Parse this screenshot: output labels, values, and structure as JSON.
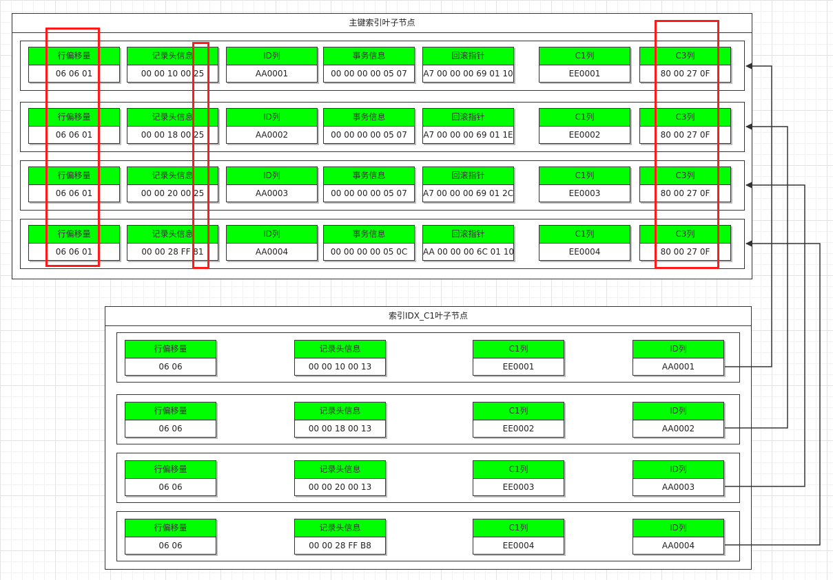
{
  "primary": {
    "title": "主键索引叶子节点",
    "rows": [
      {
        "cells": [
          {
            "h": "行偏移量",
            "v": "06 06 01"
          },
          {
            "h": "记录头信息",
            "v": "00 00 10 00 25"
          },
          {
            "h": "ID列",
            "v": "AA0001"
          },
          {
            "h": "事务信息",
            "v": "00 00 00 00 05 07"
          },
          {
            "h": "回滚指针",
            "v": "A7 00 00 00 69 01 10"
          },
          {
            "h": "C1列",
            "v": "EE0001"
          },
          {
            "h": "C3列",
            "v": "80 00 27 0F"
          }
        ]
      },
      {
        "cells": [
          {
            "h": "行偏移量",
            "v": "06 06 01"
          },
          {
            "h": "记录头信息",
            "v": "00 00 18 00 25"
          },
          {
            "h": "ID列",
            "v": "AA0002"
          },
          {
            "h": "事务信息",
            "v": "00 00 00 00 05 07"
          },
          {
            "h": "回滚指针",
            "v": "A7 00 00 00 69 01 1E"
          },
          {
            "h": "C1列",
            "v": "EE0002"
          },
          {
            "h": "C3列",
            "v": "80 00 27 0F"
          }
        ]
      },
      {
        "cells": [
          {
            "h": "行偏移量",
            "v": "06 06 01"
          },
          {
            "h": "记录头信息",
            "v": "00 00 20 00 25"
          },
          {
            "h": "ID列",
            "v": "AA0003"
          },
          {
            "h": "事务信息",
            "v": "00 00 00 00 05 07"
          },
          {
            "h": "回滚指针",
            "v": "A7 00 00 00 69 01 2C"
          },
          {
            "h": "C1列",
            "v": "EE0003"
          },
          {
            "h": "C3列",
            "v": "80 00 27 0F"
          }
        ]
      },
      {
        "cells": [
          {
            "h": "行偏移量",
            "v": "06 06 01"
          },
          {
            "h": "记录头信息",
            "v": "00 00 28 FF 81"
          },
          {
            "h": "ID列",
            "v": "AA0004"
          },
          {
            "h": "事务信息",
            "v": "00 00 00 00 05 0C"
          },
          {
            "h": "回滚指针",
            "v": "AA 00 00 00 6C 01 10"
          },
          {
            "h": "C1列",
            "v": "EE0004"
          },
          {
            "h": "C3列",
            "v": "80 00 27 0F"
          }
        ]
      }
    ]
  },
  "secondary": {
    "title": "索引IDX_C1叶子节点",
    "rows": [
      {
        "cells": [
          {
            "h": "行偏移量",
            "v": "06 06"
          },
          {
            "h": "记录头信息",
            "v": "00 00 10 00 13"
          },
          {
            "h": "C1列",
            "v": "EE0001"
          },
          {
            "h": "ID列",
            "v": "AA0001"
          }
        ]
      },
      {
        "cells": [
          {
            "h": "行偏移量",
            "v": "06 06"
          },
          {
            "h": "记录头信息",
            "v": "00 00 18 00 13"
          },
          {
            "h": "C1列",
            "v": "EE0002"
          },
          {
            "h": "ID列",
            "v": "AA0002"
          }
        ]
      },
      {
        "cells": [
          {
            "h": "行偏移量",
            "v": "06 06"
          },
          {
            "h": "记录头信息",
            "v": "00 00 20 00 13"
          },
          {
            "h": "C1列",
            "v": "EE0003"
          },
          {
            "h": "ID列",
            "v": "AA0003"
          }
        ]
      },
      {
        "cells": [
          {
            "h": "行偏移量",
            "v": "06 06"
          },
          {
            "h": "记录头信息",
            "v": "00 00 28 FF B8"
          },
          {
            "h": "C1列",
            "v": "EE0004"
          },
          {
            "h": "ID列",
            "v": "AA0004"
          }
        ]
      }
    ]
  },
  "colors": {
    "header_fill": "#00ff00",
    "highlight": "#ff1a1a",
    "line": "#333333"
  }
}
